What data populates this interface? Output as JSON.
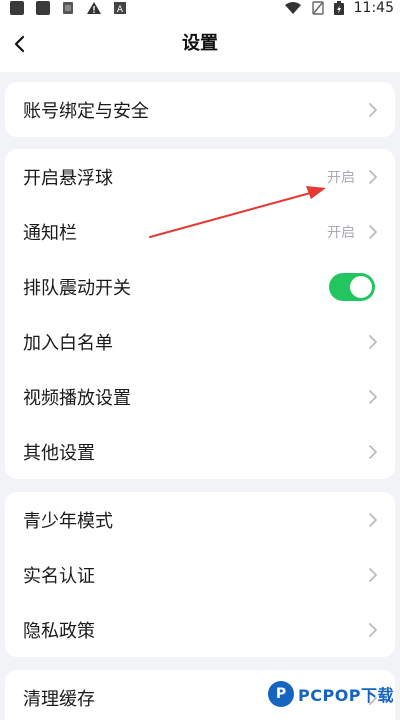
{
  "status_bar": {
    "time": "11:45",
    "icons": [
      "notification-square-icon",
      "notification-square-icon",
      "sim-icon",
      "warning-icon",
      "app-icon",
      "wifi-icon",
      "no-sim-icon",
      "battery-charging-icon"
    ]
  },
  "nav": {
    "title": "设置",
    "back_icon": "chevron-left-icon"
  },
  "groups": [
    {
      "items": [
        {
          "label": "账号绑定与安全",
          "type": "link"
        }
      ]
    },
    {
      "items": [
        {
          "label": "开启悬浮球",
          "value": "开启",
          "type": "link"
        },
        {
          "label": "通知栏",
          "value": "开启",
          "type": "link"
        },
        {
          "label": "排队震动开关",
          "type": "toggle",
          "on": true
        },
        {
          "label": "加入白名单",
          "type": "link"
        },
        {
          "label": "视频播放设置",
          "type": "link"
        },
        {
          "label": "其他设置",
          "type": "link"
        }
      ]
    },
    {
      "items": [
        {
          "label": "青少年模式",
          "type": "link"
        },
        {
          "label": "实名认证",
          "type": "link"
        },
        {
          "label": "隐私政策",
          "type": "link"
        }
      ]
    },
    {
      "items": [
        {
          "label": "清理缓存",
          "type": "link"
        }
      ]
    }
  ],
  "colors": {
    "toggle_on": "#22c55e",
    "annotation_arrow": "#e53935",
    "page_bg": "#f2f3f7"
  },
  "watermark": {
    "text": "PCPOP下载"
  }
}
